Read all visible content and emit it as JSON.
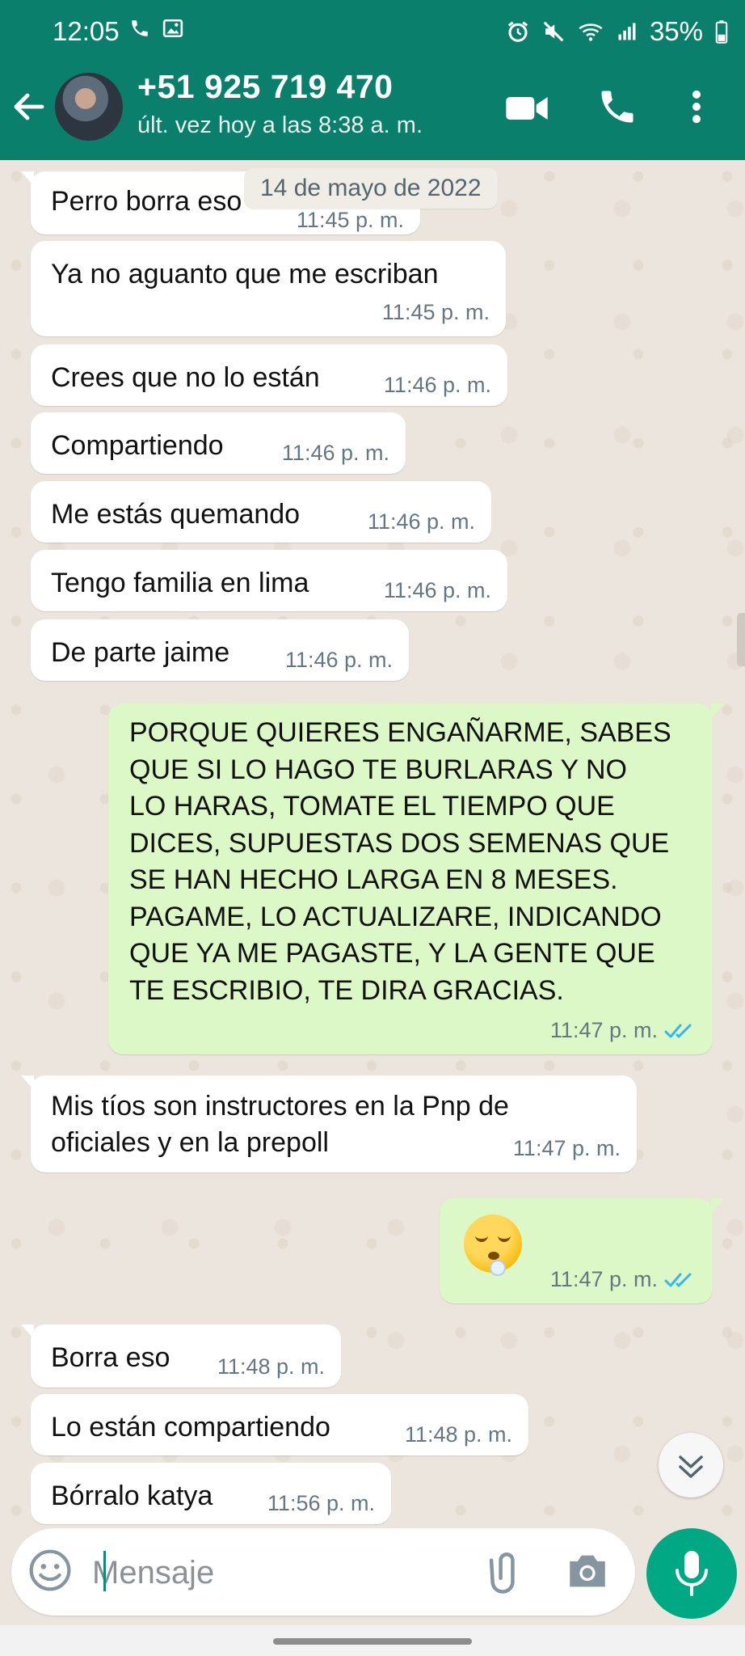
{
  "status_bar": {
    "time": "12:05",
    "battery": "35%"
  },
  "header": {
    "contact_name": "+51 925 719 470",
    "last_seen": "últ. vez hoy a las 8:38 a. m."
  },
  "chat": {
    "date_chip": "14 de mayo de 2022",
    "messages": [
      {
        "dir": "in",
        "text": "Perro borra eso",
        "time": "11:45 p. m."
      },
      {
        "dir": "in",
        "text": "Ya no aguanto que me escriban",
        "time": "11:45 p. m."
      },
      {
        "dir": "in",
        "text": "Crees que no lo están",
        "time": "11:46 p. m."
      },
      {
        "dir": "in",
        "text": "Compartiendo",
        "time": "11:46 p. m."
      },
      {
        "dir": "in",
        "text": "Me estás quemando",
        "time": "11:46 p. m."
      },
      {
        "dir": "in",
        "text": "Tengo familia en lima",
        "time": "11:46 p. m."
      },
      {
        "dir": "in",
        "text": "De parte jaime",
        "time": "11:46 p. m."
      },
      {
        "dir": "out",
        "text": "PORQUE QUIERES ENGAÑARME, SABES\nQUE SI LO HAGO TE BURLARAS Y NO\nLO HARAS, TOMATE EL TIEMPO QUE\nDICES, SUPUESTAS DOS SEMENAS QUE\nSE HAN HECHO LARGA EN 8 MESES.\nPAGAME, LO ACTUALIZARE, INDICANDO\nQUE YA ME PAGASTE, Y LA GENTE QUE\nTE ESCRIBIO, TE DIRA GRACIAS.",
        "time": "11:47 p. m.",
        "status": "read"
      },
      {
        "dir": "in",
        "text": "Mis tíos son instructores en la Pnp de\noficiales y en la prepoll",
        "time": "11:47 p. m."
      },
      {
        "dir": "out",
        "text": "",
        "emoji": "sleepy-face",
        "time": "11:47 p. m.",
        "status": "read"
      },
      {
        "dir": "in",
        "text": "Borra eso",
        "time": "11:48 p. m."
      },
      {
        "dir": "in",
        "text": "Lo están compartiendo",
        "time": "11:48 p. m."
      },
      {
        "dir": "in",
        "text": "Bórralo katya",
        "time": "11:56 p. m."
      }
    ]
  },
  "composer": {
    "placeholder": "Mensaje"
  },
  "colors": {
    "header": "#0a7f6b",
    "incoming": "#ffffff",
    "outgoing": "#dcf8c6",
    "mic": "#00a884",
    "read_ticks": "#34b7f1"
  },
  "icons": [
    "phone-icon",
    "image-icon",
    "alarm-icon",
    "mute-icon",
    "wifi-icon",
    "signal-icon",
    "battery-icon",
    "back-arrow-icon",
    "video-call-icon",
    "voice-call-icon",
    "more-vert-icon",
    "double-check-icon",
    "chevron-double-down-icon",
    "emoji-icon",
    "paperclip-icon",
    "camera-icon",
    "mic-icon"
  ]
}
